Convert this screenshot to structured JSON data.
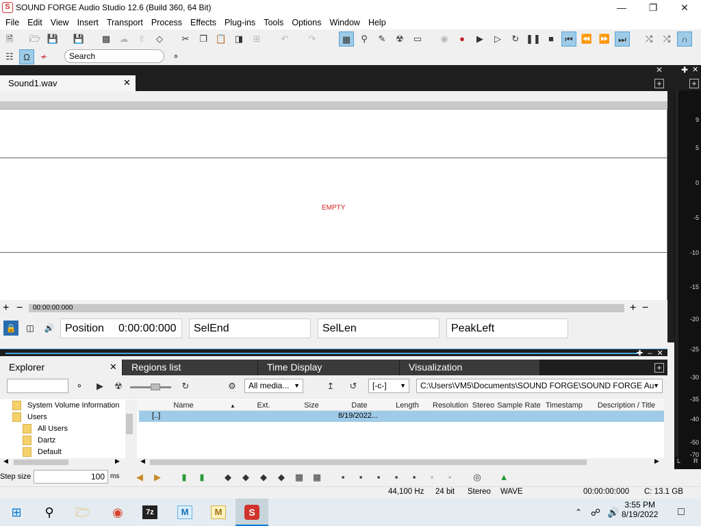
{
  "window": {
    "title": "SOUND FORGE Audio Studio 12.6 (Build 360, 64 Bit)",
    "logo_letter": "S"
  },
  "menu": [
    "File",
    "Edit",
    "View",
    "Insert",
    "Transport",
    "Process",
    "Effects",
    "Plug-ins",
    "Tools",
    "Options",
    "Window",
    "Help"
  ],
  "search": {
    "placeholder": "Search"
  },
  "document": {
    "tab_label": "Sound1.wav",
    "empty_label": "EMPTY",
    "time_readout": "00:00:00:000"
  },
  "status_boxes": {
    "position_label": "Position",
    "position_value": "0:00:00:000",
    "selend": "SelEnd",
    "sellen": "SelLen",
    "peakleft": "PeakLeft"
  },
  "meter": {
    "ticks": [
      "9",
      "5",
      "0",
      "-5",
      "-10",
      "-15",
      "-20",
      "-25",
      "-30",
      "-35",
      "-40",
      "-50",
      "-70"
    ],
    "left": "L",
    "right": "R"
  },
  "bottom_tabs": [
    "Explorer",
    "Regions list",
    "Time Display",
    "Visualization"
  ],
  "explorer": {
    "filter_value": "All media...",
    "drive_value": "[-c-]",
    "path_value": "C:\\Users\\VM5\\Documents\\SOUND FORGE\\SOUND FORGE Au",
    "tree": [
      "System Volume Information",
      "Users",
      "All Users",
      "Dartz",
      "Default"
    ],
    "columns": [
      "Name",
      "Ext.",
      "Size",
      "Date",
      "Length",
      "Resolution",
      "Stereo",
      "Sample Rate",
      "Timestamp",
      "Description / Title"
    ],
    "row": {
      "name": "[..]",
      "date": "8/19/2022..."
    }
  },
  "stepbar": {
    "label": "Step size",
    "value": "100",
    "unit": "ms"
  },
  "statusbar": {
    "rate": "44,100 Hz",
    "bits": "24 bit",
    "channels": "Stereo",
    "format": "WAVE",
    "time": "00:00:00:000",
    "disk": "C: 13.1 GB"
  },
  "taskbar": {
    "time": "3:55 PM",
    "date": "8/19/2022",
    "app_7z": "7z",
    "app_m": "M",
    "app_s": "S"
  }
}
